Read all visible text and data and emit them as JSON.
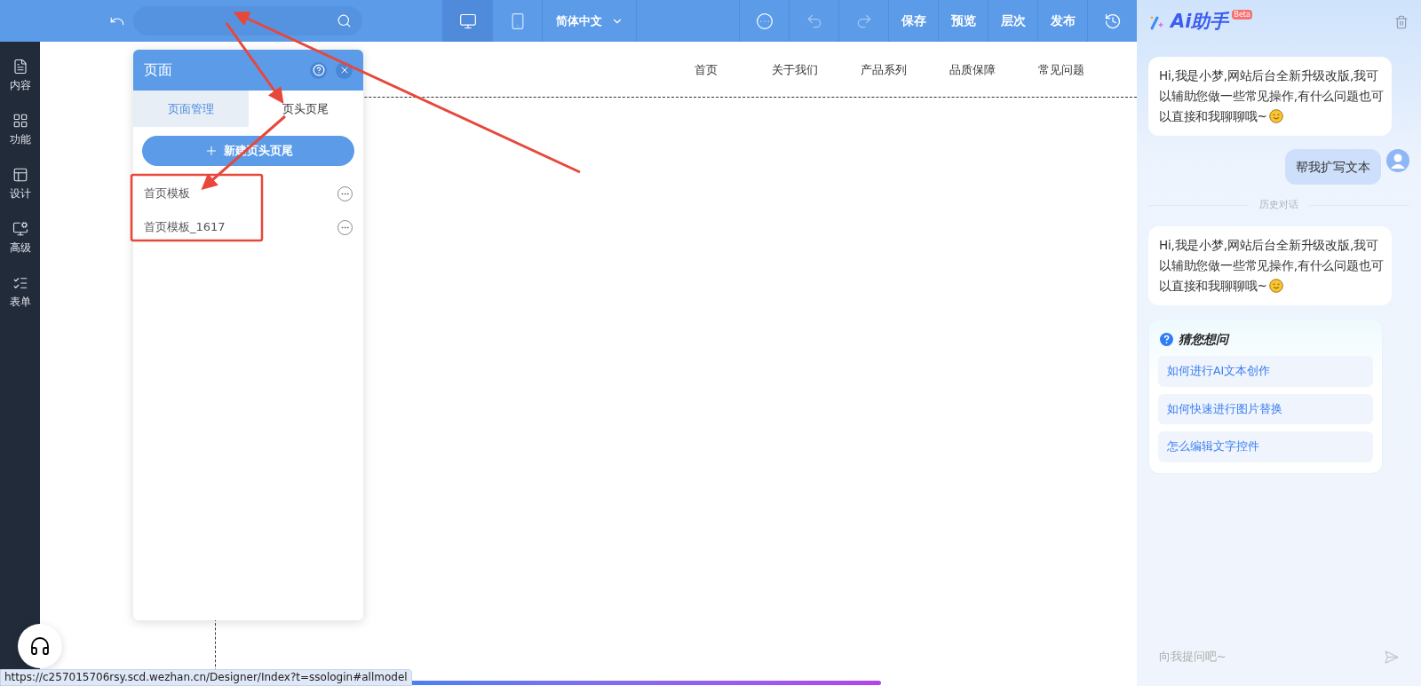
{
  "toolbar": {
    "back": {
      "kind": "back"
    },
    "devices": [
      {
        "kind": "desktop",
        "selected": true
      },
      {
        "kind": "mobile",
        "selected": false
      }
    ],
    "language": "简体中文",
    "actions": [
      {
        "kind": "more"
      },
      {
        "kind": "undo",
        "disabled": true
      },
      {
        "kind": "redo",
        "disabled": true
      },
      {
        "kind": "text",
        "label": "保存"
      },
      {
        "kind": "text",
        "label": "预览"
      },
      {
        "kind": "text",
        "label": "层次"
      },
      {
        "kind": "text",
        "label": "发布"
      },
      {
        "kind": "history"
      }
    ]
  },
  "sidebar": {
    "items": [
      {
        "kind": "content",
        "label": "内容"
      },
      {
        "kind": "feature",
        "label": "功能"
      },
      {
        "kind": "design",
        "label": "设计"
      },
      {
        "kind": "advanced",
        "label": "高级"
      },
      {
        "kind": "form",
        "label": "表单"
      }
    ]
  },
  "page_panel": {
    "title": "页面",
    "tabs": [
      {
        "label": "页面管理",
        "selected": false
      },
      {
        "label": "页头页尾",
        "selected": true
      }
    ],
    "new_button": "新建页头页尾",
    "items": [
      {
        "label": "首页模板"
      },
      {
        "label": "首页模板_1617"
      }
    ]
  },
  "canvas": {
    "nav": [
      "首页",
      "关于我们",
      "产品系列",
      "品质保障",
      "常见问题"
    ]
  },
  "assistant": {
    "title": "Ai助手",
    "badge": "Beta",
    "messages": [
      {
        "kind": "bot",
        "text": "Hi,我是小梦,网站后台全新升级改版,我可以辅助您做一些常见操作,有什么问题也可以直接和我聊聊哦~"
      },
      {
        "kind": "user",
        "text": "帮我扩写文本"
      },
      {
        "kind": "divider",
        "text": "历史对话"
      },
      {
        "kind": "bot",
        "text": "Hi,我是小梦,网站后台全新升级改版,我可以辅助您做一些常见操作,有什么问题也可以直接和我聊聊哦~"
      },
      {
        "kind": "suggestions",
        "title": "猜您想问",
        "items": [
          "如何进行AI文本创作",
          "如何快速进行图片替换",
          "怎么编辑文字控件"
        ]
      }
    ],
    "input": {
      "placeholder": "向我提问吧~"
    }
  },
  "status_url": "https://c257015706rsy.scd.wezhan.cn/Designer/Index?t=ssologin#allmodel"
}
